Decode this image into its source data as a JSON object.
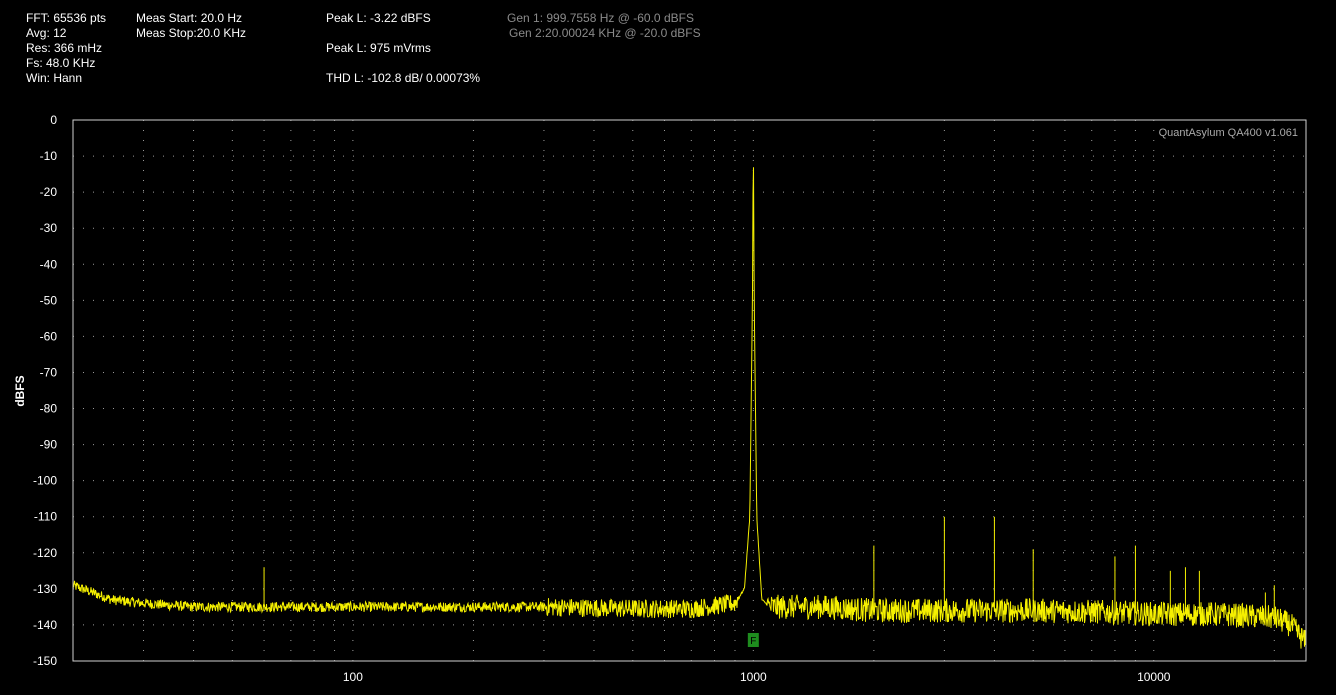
{
  "stats": {
    "fft": "FFT: 65536 pts",
    "avg": "Avg: 12",
    "res": "Res: 366 mHz",
    "fs": "Fs: 48.0 KHz",
    "win": "Win: Hann",
    "meas_start": "Meas Start: 20.0 Hz",
    "meas_stop": "Meas Stop:20.0 KHz",
    "peak_l": "Peak L: -3.22 dBFS",
    "peak_mv": "Peak L: 975 mVrms",
    "thd_l": "THD L: -102.8 dB/ 0.00073%",
    "gen1": "Gen 1: 999.7558 Hz @ -60.0  dBFS",
    "gen2": "Gen 2:20.00024 KHz @ -20.0  dBFS"
  },
  "colors": {
    "trace": "#f5f000",
    "grid": "#9a9a9a",
    "marker": "#1e8c1e",
    "watermark": "#aaaaaa"
  },
  "chart_data": {
    "type": "line",
    "title": "",
    "xlabel": "",
    "ylabel": "dBFS",
    "watermark": "QuantAsylum QA400 v1.061",
    "x_scale": "log",
    "xlim": [
      20,
      24000
    ],
    "ylim": [
      -150,
      0
    ],
    "x_ticks": [
      100,
      1000,
      10000
    ],
    "y_ticks": [
      0,
      -10,
      -20,
      -30,
      -40,
      -50,
      -60,
      -70,
      -80,
      -90,
      -100,
      -110,
      -120,
      -130,
      -140,
      -150
    ],
    "grid": true,
    "marker_label": "F",
    "marker_freq": 1000,
    "series": [
      {
        "x": [
          20,
          25,
          30,
          40,
          50,
          60,
          70,
          100,
          200,
          300,
          500,
          700,
          900,
          950,
          980,
          995,
          1000,
          1005,
          1020,
          1050,
          1100,
          1500,
          2000,
          3000,
          5000,
          8000,
          10000,
          14000,
          17000,
          20000,
          22000,
          24000
        ],
        "y": [
          -129,
          -133,
          -134,
          -135,
          -135,
          -135,
          -135,
          -135,
          -135,
          -135,
          -135.5,
          -135.5,
          -134,
          -130,
          -110,
          -50,
          -3.22,
          -50,
          -110,
          -133,
          -135,
          -135,
          -136,
          -136,
          -136,
          -136.5,
          -137,
          -137,
          -137.5,
          -138,
          -140,
          -145
        ]
      }
    ],
    "spikes": [
      {
        "x": 60,
        "y": -124
      },
      {
        "x": 2000,
        "y": -118
      },
      {
        "x": 3000,
        "y": -110
      },
      {
        "x": 4000,
        "y": -110
      },
      {
        "x": 5000,
        "y": -119
      },
      {
        "x": 8000,
        "y": -121
      },
      {
        "x": 9000,
        "y": -118
      },
      {
        "x": 11000,
        "y": -125
      },
      {
        "x": 12000,
        "y": -124
      },
      {
        "x": 13000,
        "y": -125
      },
      {
        "x": 19000,
        "y": -131
      },
      {
        "x": 20000,
        "y": -129
      }
    ]
  }
}
